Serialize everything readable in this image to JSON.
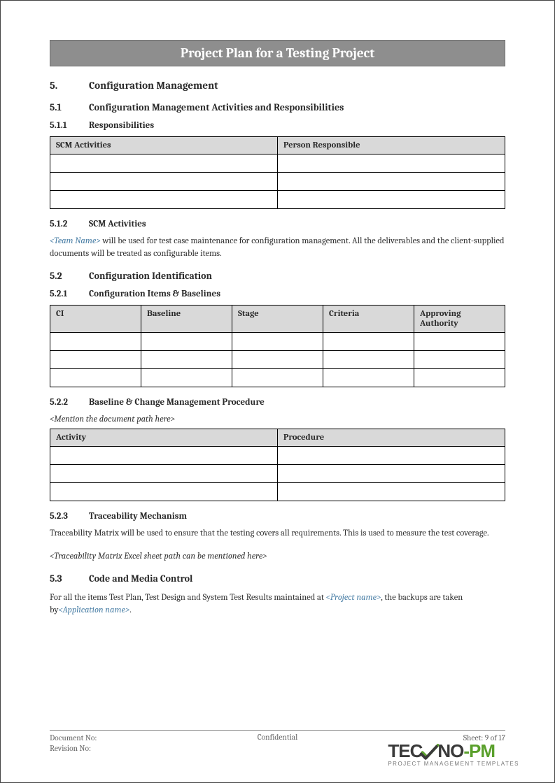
{
  "title": "Project Plan for a Testing Project",
  "sections": {
    "s5": {
      "num": "5.",
      "title": "Configuration Management"
    },
    "s51": {
      "num": "5.1",
      "title": "Configuration Management Activities and Responsibilities"
    },
    "s511": {
      "num": "5.1.1",
      "title": "Responsibilities"
    },
    "s512": {
      "num": "5.1.2",
      "title": "SCM Activities"
    },
    "s52": {
      "num": "5.2",
      "title": "Configuration Identification"
    },
    "s521": {
      "num": "5.2.1",
      "title": "Configuration Items & Baselines"
    },
    "s522": {
      "num": "5.2.2",
      "title": "Baseline & Change Management Procedure"
    },
    "s523": {
      "num": "5.2.3",
      "title": "Traceability Mechanism"
    },
    "s53": {
      "num": "5.3",
      "title": "Code and Media Control"
    }
  },
  "tables": {
    "responsibilities": {
      "headers": [
        "SCM Activities",
        "Person Responsible"
      ]
    },
    "ci_baselines": {
      "headers": [
        "CI",
        "Baseline",
        "Stage",
        "Criteria",
        "Approving Authority"
      ]
    },
    "baseline_change": {
      "headers": [
        "Activity",
        "Procedure"
      ]
    }
  },
  "text": {
    "scm_activities_p1a": "<Team Name>",
    "scm_activities_p1b": " will be used for test case maintenance for configuration management. All the deliverables and the client-supplied documents will be treated as configurable items.",
    "baseline_change_note": "<Mention the document path here>",
    "traceability_p1": "Traceability Matrix will be used to ensure that the testing covers all requirements. This is used to measure the test coverage.",
    "traceability_note": "<Traceability Matrix Excel sheet path can be mentioned here>",
    "code_media_a": "For all the items Test Plan, Test Design and System Test Results maintained at ",
    "code_media_b": "<Project name>",
    "code_media_c": ", the backups are taken by",
    "code_media_d": "<Application name>",
    "code_media_e": "."
  },
  "footer": {
    "doc_no_label": "Document No:",
    "rev_no_label": "Revision No:",
    "confidential": "Confidential",
    "sheet": "Sheet: 9 of 17"
  },
  "logo": {
    "part1": "TEC",
    "part2": "NO",
    "part3": "-PM",
    "sub": "PROJECT MANAGEMENT TEMPLATES"
  }
}
